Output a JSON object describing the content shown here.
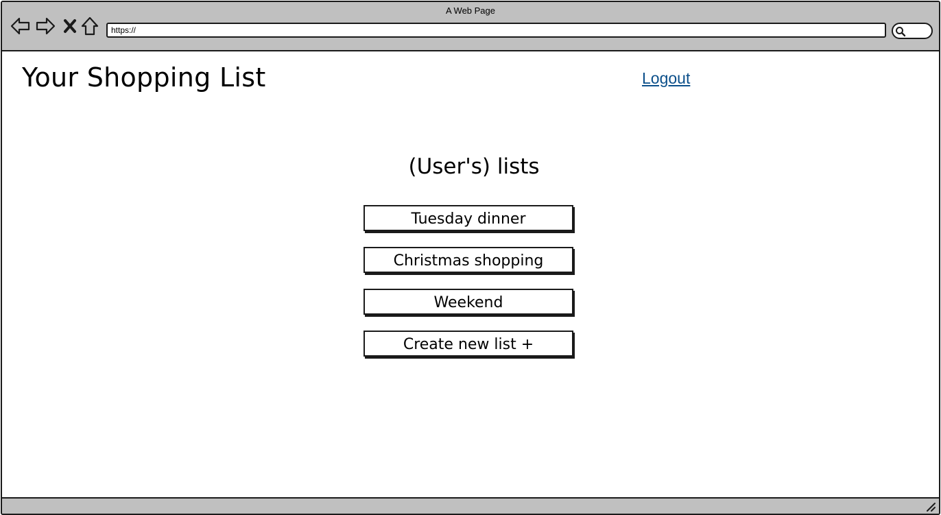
{
  "browser": {
    "window_title": "A Web Page",
    "address_url": "https://"
  },
  "header": {
    "title": "Your Shopping List",
    "logout_label": "Logout"
  },
  "main": {
    "section_heading": "(User's) lists",
    "lists": [
      {
        "label": "Tuesday dinner"
      },
      {
        "label": "Christmas shopping"
      },
      {
        "label": "Weekend"
      }
    ],
    "create_label": "Create new list +"
  },
  "colors": {
    "chrome_gray": "#c0c0c0",
    "link_blue": "#0b4f8a"
  },
  "icons": [
    "back-arrow-icon",
    "forward-arrow-icon",
    "close-icon",
    "home-icon",
    "search-icon",
    "resize-grip-icon"
  ]
}
